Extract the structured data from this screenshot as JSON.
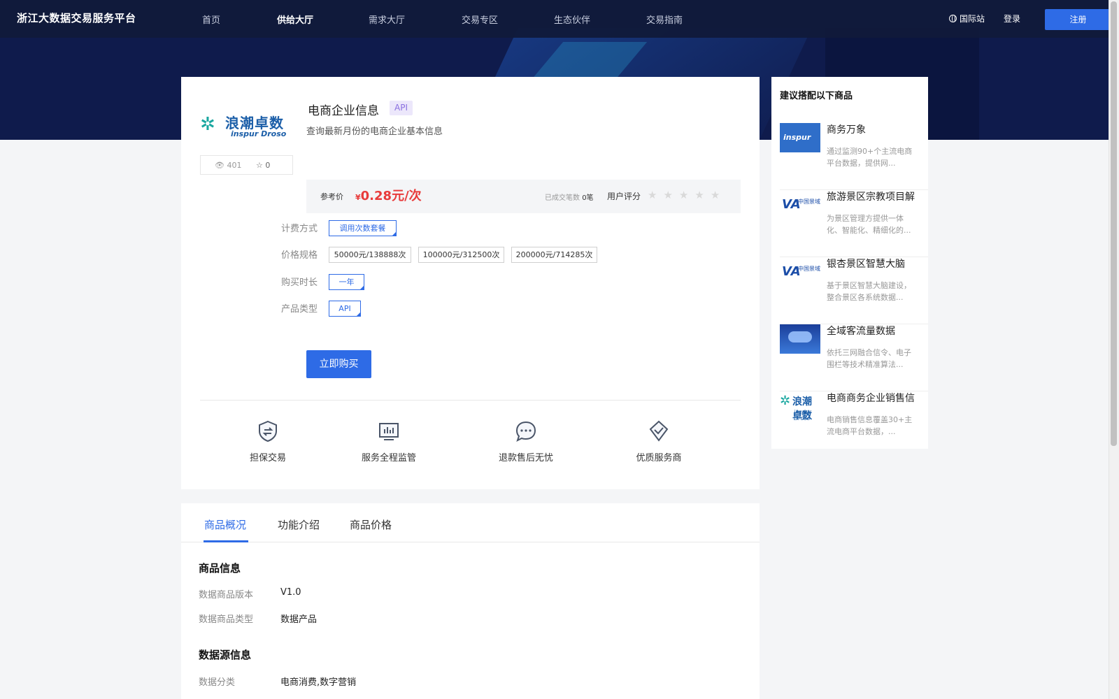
{
  "header": {
    "platform_name": "浙江大数据交易服务平台",
    "nav": [
      "首页",
      "供给大厅",
      "需求大厅",
      "交易专区",
      "生态伙伴",
      "交易指南"
    ],
    "active_nav": "供给大厅",
    "intl_label": "国际站",
    "login_label": "登录",
    "register_label": "注册"
  },
  "product": {
    "brand_logo": {
      "cn": "浪潮卓数",
      "en": "inspur Droso"
    },
    "views": "401",
    "favorites": "0",
    "title": "电商企业信息",
    "type_badge": "API",
    "description": "查询最新月份的电商企业基本信息",
    "price_label": "参考价",
    "currency_symbol": "¥",
    "price": "0.28元/次",
    "deals_label": "已成交笔数",
    "deals_value": "0笔",
    "rating_label": "用户评分",
    "rating_stars": 0,
    "options": {
      "billing": {
        "label": "计费方式",
        "values": [
          "调用次数套餐"
        ],
        "selected": 0
      },
      "spec": {
        "label": "价格规格",
        "values": [
          "50000元/138888次",
          "100000元/312500次",
          "200000元/714285次"
        ],
        "selected": -1
      },
      "duration": {
        "label": "购买时长",
        "values": [
          "一年"
        ],
        "selected": 0
      },
      "type": {
        "label": "产品类型",
        "values": [
          "API"
        ],
        "selected": 0
      }
    },
    "buy_label": "立即购买",
    "guarantees": [
      "担保交易",
      "服务全程监管",
      "退款售后无忧",
      "优质服务商"
    ]
  },
  "tabs": {
    "items": [
      "商品概况",
      "功能介绍",
      "商品价格"
    ],
    "active": 0
  },
  "details": {
    "product_info_title": "商品信息",
    "version_label": "数据商品版本",
    "version_value": "V1.0",
    "type_label": "数据商品类型",
    "type_value": "数据产品",
    "source_title": "数据源信息",
    "category_label": "数据分类",
    "category_value": "电商消费,数字营销"
  },
  "sidebar": {
    "title": "建议搭配以下商品",
    "items": [
      {
        "title": "商务万象",
        "desc": "通过监测90+个主流电商平台数据，提供网...",
        "thumb": "inspur",
        "thumb_text": "inspur 浪潮"
      },
      {
        "title": "旅游景区宗教项目解",
        "desc": "为景区管理方提供一体化、智能化、精细化的...",
        "thumb": "chinams",
        "thumb_text": "中国景域"
      },
      {
        "title": "银杏景区智慧大脑",
        "desc": "基于景区智慧大脑建设，整合景区各系统数据...",
        "thumb": "chinams",
        "thumb_text": "中国景域"
      },
      {
        "title": "全域客流量数据",
        "desc": "依托三网融合信令、电子围栏等技术精准算法...",
        "thumb": "cloud",
        "thumb_text": ""
      },
      {
        "title": "电商商务企业销售信",
        "desc": "电商销售信息覆盖30+主流电商平台数据，...",
        "thumb": "lcz",
        "thumb_text": "浪潮卓数"
      }
    ]
  }
}
